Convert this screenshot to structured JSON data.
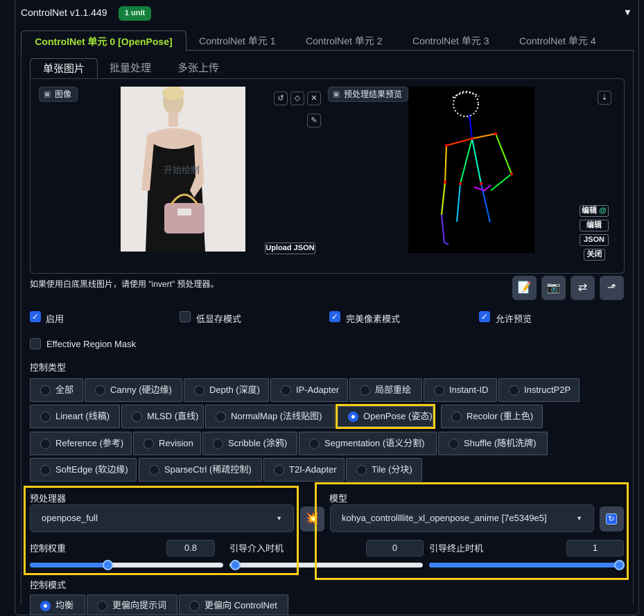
{
  "header": {
    "title": "ControlNet v1.1.449",
    "badge": "1 unit"
  },
  "tabs": [
    "ControlNet 单元 0 [OpenPose]",
    "ControlNet 单元 1",
    "ControlNet 单元 2",
    "ControlNet 单元 3",
    "ControlNet 单元 4"
  ],
  "subtabs": [
    "单张图片",
    "批量处理",
    "多张上传"
  ],
  "image": {
    "label": "图像",
    "overlay": "开始绘制",
    "upload_json": "Upload JSON"
  },
  "preview": {
    "label": "预处理结果预览",
    "edit_buttons": [
      "编辑",
      "编辑",
      "JSON",
      "关闭"
    ]
  },
  "hint": "如果使用白底黑线图片，请使用 \"invert\" 预处理器。",
  "checks": [
    {
      "label": "启用",
      "checked": true
    },
    {
      "label": "低显存模式",
      "checked": false
    },
    {
      "label": "完美像素模式",
      "checked": true
    },
    {
      "label": "允许预览",
      "checked": true
    },
    {
      "label": "Effective Region Mask",
      "checked": false
    }
  ],
  "control_type": {
    "label": "控制类型",
    "rows": [
      [
        "全部",
        "Canny (硬边缘)",
        "Depth (深度)",
        "IP-Adapter",
        "局部重绘",
        "Instant-ID",
        "InstructP2P"
      ],
      [
        "Lineart (线稿)",
        "MLSD (直线)",
        "NormalMap (法线贴图)",
        "OpenPose (姿态)",
        "Recolor (重上色)"
      ],
      [
        "Reference (参考)",
        "Revision",
        "Scribble (涂鸦)",
        "Segmentation (语义分割)",
        "Shuffle (随机洗牌)"
      ],
      [
        "SoftEdge (软边缘)",
        "SparseCtrl (稀疏控制)",
        "T2I-Adapter",
        "Tile (分块)"
      ]
    ],
    "selected": "OpenPose (姿态)"
  },
  "preprocessor": {
    "label": "预处理器",
    "value": "openpose_full"
  },
  "model": {
    "label": "模型",
    "value": "kohya_controllllite_xl_openpose_anime [7e5349e5]"
  },
  "sliders": {
    "weight": {
      "label": "控制权重",
      "value": "0.8"
    },
    "start": {
      "label": "引导介入时机",
      "value": "0"
    },
    "end": {
      "label": "引导终止时机",
      "value": "1"
    }
  },
  "control_mode": {
    "label": "控制模式",
    "options": [
      "均衡",
      "更偏向提示词",
      "更偏向 ControlNet"
    ],
    "selected": "均衡"
  }
}
